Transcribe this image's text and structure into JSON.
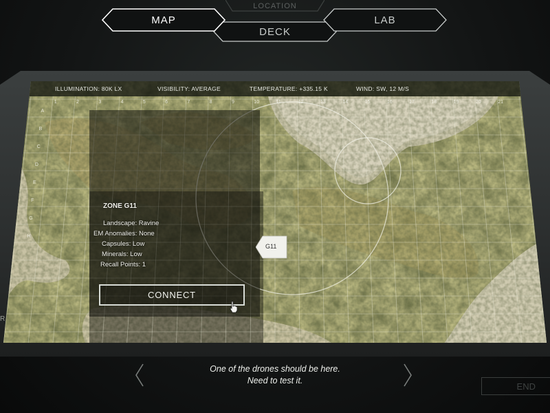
{
  "nav": {
    "location_label": "LOCATION",
    "map_label": "MAP",
    "lab_label": "LAB",
    "deck_label": "DECK",
    "active_tab": "MAP"
  },
  "status": {
    "illumination": "ILLUMINATION: 80K LX",
    "visibility": "VISIBILITY: AVERAGE",
    "temperature": "TEMPERATURE: +335.15 K",
    "wind": "WIND: SW, 12 M/S"
  },
  "grid": {
    "columns": [
      "1",
      "2",
      "3",
      "4",
      "5",
      "6",
      "7",
      "8",
      "9",
      "10",
      "11",
      "12",
      "13",
      "14",
      "15",
      "16",
      "17",
      "18",
      "19",
      "20",
      "21"
    ],
    "rows": [
      "A",
      "B",
      "C",
      "D",
      "E",
      "F",
      "G",
      "H"
    ]
  },
  "zone": {
    "title": "ZONE G11",
    "landscape": "Landscape: Ravine",
    "em_anomalies": "EM Anomalies: None",
    "capsules": "Capsules: Low",
    "minerals": "Minerals: Low",
    "recall_points": "Recall Points: 1",
    "connect_label": "CONNECT",
    "marker_label": "G11"
  },
  "subtitle": {
    "line1": "One of the drones should be here.",
    "line2": "Need to test it."
  },
  "end_label": "END",
  "edge_glyph": "R",
  "colors": {
    "text": "#f2f2ec",
    "frame": "#2b2e2e",
    "background": "#0c0d0d"
  }
}
